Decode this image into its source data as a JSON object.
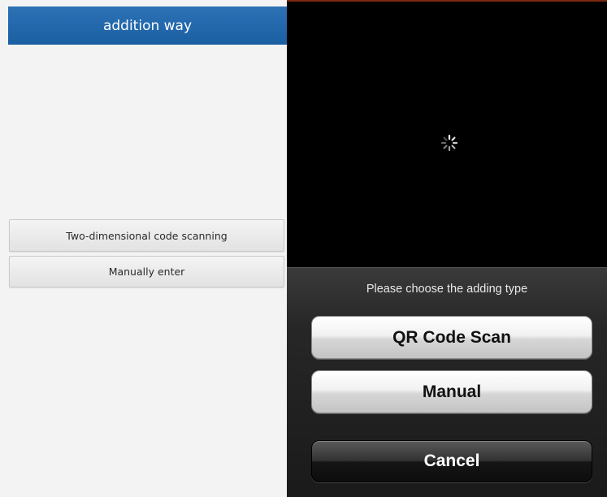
{
  "left": {
    "header_title": "addition way",
    "buttons": [
      {
        "label": "Two-dimensional code scanning"
      },
      {
        "label": "Manually enter"
      }
    ]
  },
  "right": {
    "spinner_icon": "loading-spinner-icon",
    "sheet": {
      "title": "Please choose the adding type",
      "buttons": [
        {
          "label": "QR Code Scan"
        },
        {
          "label": "Manual"
        }
      ],
      "cancel_label": "Cancel"
    }
  },
  "colors": {
    "header_blue": "#1b5fa3",
    "background_light": "#f3f3f3",
    "background_dark": "#000000"
  }
}
